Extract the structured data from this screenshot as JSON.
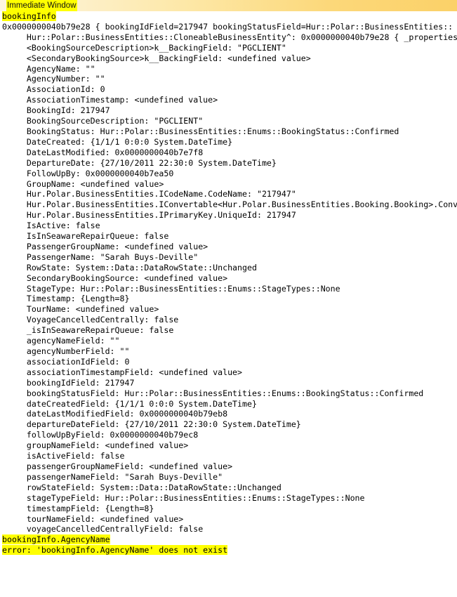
{
  "window": {
    "title": "Immediate Window",
    "title_highlight_color": "#ffff00",
    "titlebar_gradient_from": "#fdf6e3",
    "titlebar_gradient_to": "#fbd168"
  },
  "colors": {
    "background": "#ffffff",
    "text": "#000000",
    "highlight": "#ffff00"
  },
  "console": {
    "lines": [
      {
        "text": "bookingInfo",
        "highlight": true
      },
      {
        "text": "0x0000000040b79e28 { bookingIdField=217947 bookingStatusField=Hur::Polar::BusinessEntities::",
        "highlight": false
      },
      {
        "text": "     Hur::Polar::BusinessEntities::CloneableBusinessEntity^: 0x0000000040b79e28 { _properties",
        "highlight": false
      },
      {
        "text": "     <BookingSourceDescription>k__BackingField: \"PGCLIENT\"",
        "highlight": false
      },
      {
        "text": "     <SecondaryBookingSource>k__BackingField: <undefined value>",
        "highlight": false
      },
      {
        "text": "     AgencyName: \"\"",
        "highlight": false
      },
      {
        "text": "     AgencyNumber: \"\"",
        "highlight": false
      },
      {
        "text": "     AssociationId: 0",
        "highlight": false
      },
      {
        "text": "     AssociationTimestamp: <undefined value>",
        "highlight": false
      },
      {
        "text": "     BookingId: 217947",
        "highlight": false
      },
      {
        "text": "     BookingSourceDescription: \"PGCLIENT\"",
        "highlight": false
      },
      {
        "text": "     BookingStatus: Hur::Polar::BusinessEntities::Enums::BookingStatus::Confirmed",
        "highlight": false
      },
      {
        "text": "     DateCreated: {1/1/1 0:0:0 System.DateTime}",
        "highlight": false
      },
      {
        "text": "     DateLastModified: 0x0000000040b7e7f8",
        "highlight": false
      },
      {
        "text": "     DepartureDate: {27/10/2011 22:30:0 System.DateTime}",
        "highlight": false
      },
      {
        "text": "     FollowUpBy: 0x0000000040b7ea50",
        "highlight": false
      },
      {
        "text": "     GroupName: <undefined value>",
        "highlight": false
      },
      {
        "text": "     Hur.Polar.BusinessEntities.ICodeName.CodeName: \"217947\"",
        "highlight": false
      },
      {
        "text": "     Hur.Polar.BusinessEntities.IConvertable<Hur.Polar.BusinessEntities.Booking.Booking>.Conv",
        "highlight": false
      },
      {
        "text": "     Hur.Polar.BusinessEntities.IPrimaryKey.UniqueId: 217947",
        "highlight": false
      },
      {
        "text": "     IsActive: false",
        "highlight": false
      },
      {
        "text": "     IsInSeawareRepairQueue: false",
        "highlight": false
      },
      {
        "text": "     PassengerGroupName: <undefined value>",
        "highlight": false
      },
      {
        "text": "     PassengerName: \"Sarah Buys-Deville\"",
        "highlight": false
      },
      {
        "text": "     RowState: System::Data::DataRowState::Unchanged",
        "highlight": false
      },
      {
        "text": "     SecondaryBookingSource: <undefined value>",
        "highlight": false
      },
      {
        "text": "     StageType: Hur::Polar::BusinessEntities::Enums::StageTypes::None",
        "highlight": false
      },
      {
        "text": "     Timestamp: {Length=8}",
        "highlight": false
      },
      {
        "text": "     TourName: <undefined value>",
        "highlight": false
      },
      {
        "text": "     VoyageCancelledCentrally: false",
        "highlight": false
      },
      {
        "text": "     _isInSeawareRepairQueue: false",
        "highlight": false
      },
      {
        "text": "     agencyNameField: \"\"",
        "highlight": false
      },
      {
        "text": "     agencyNumberField: \"\"",
        "highlight": false
      },
      {
        "text": "     associationIdField: 0",
        "highlight": false
      },
      {
        "text": "     associationTimestampField: <undefined value>",
        "highlight": false
      },
      {
        "text": "     bookingIdField: 217947",
        "highlight": false
      },
      {
        "text": "     bookingStatusField: Hur::Polar::BusinessEntities::Enums::BookingStatus::Confirmed",
        "highlight": false
      },
      {
        "text": "     dateCreatedField: {1/1/1 0:0:0 System.DateTime}",
        "highlight": false
      },
      {
        "text": "     dateLastModifiedField: 0x0000000040b79eb8",
        "highlight": false
      },
      {
        "text": "     departureDateField: {27/10/2011 22:30:0 System.DateTime}",
        "highlight": false
      },
      {
        "text": "     followUpByField: 0x0000000040b79ec8",
        "highlight": false
      },
      {
        "text": "     groupNameField: <undefined value>",
        "highlight": false
      },
      {
        "text": "     isActiveField: false",
        "highlight": false
      },
      {
        "text": "     passengerGroupNameField: <undefined value>",
        "highlight": false
      },
      {
        "text": "     passengerNameField: \"Sarah Buys-Deville\"",
        "highlight": false
      },
      {
        "text": "     rowStateField: System::Data::DataRowState::Unchanged",
        "highlight": false
      },
      {
        "text": "     stageTypeField: Hur::Polar::BusinessEntities::Enums::StageTypes::None",
        "highlight": false
      },
      {
        "text": "     timestampField: {Length=8}",
        "highlight": false
      },
      {
        "text": "     tourNameField: <undefined value>",
        "highlight": false
      },
      {
        "text": "     voyageCancelledCentrallyField: false",
        "highlight": false
      },
      {
        "text": "bookingInfo.AgencyName",
        "highlight": true
      },
      {
        "text": "error: 'bookingInfo.AgencyName' does not exist",
        "highlight": true
      }
    ]
  }
}
